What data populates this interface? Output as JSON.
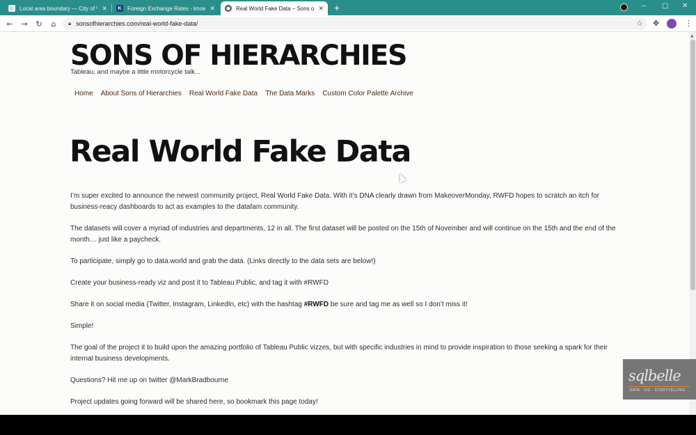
{
  "browser": {
    "tabs": [
      {
        "title": "Local area boundary — City of Va",
        "favicon": "city-logo-icon",
        "active": false
      },
      {
        "title": "Foreign Exchange Rates - knoem",
        "favicon": "knoema-k-icon",
        "favicon_text": "K",
        "active": false
      },
      {
        "title": "Real World Fake Data – Sons of Hi",
        "favicon": "sons-of-hierarchies-icon",
        "active": true
      }
    ],
    "new_tab": "+",
    "window_controls": {
      "minimize": "–",
      "maximize": "▢",
      "close": "✕"
    },
    "url": "sonsofhierarchies.com/real-world-fake-data/"
  },
  "site": {
    "title": "SONS OF HIERARCHIES",
    "tagline": "Tableau, and maybe a little motorcycle talk...",
    "nav": [
      "Home",
      "About Sons of Hierarchies",
      "Real World Fake Data",
      "The Data Marks",
      "Custom Color Palette Archive"
    ]
  },
  "post": {
    "title": "Real World Fake Data",
    "paragraphs": [
      "I’m super excited to announce the newest community project, Real World Fake Data. With it’s DNA clearly drawn from MakeoverMonday, RWFD hopes to scratch an itch for business-reacy dashboards to act as examples to the datafam community.",
      "The datasets will cover a myriad of industries and departments, 12 in all. The first dataset will be posted on the 15th of November and will continue on the 15th and the end of the month… just like a paycheck.",
      "To participate, simply go to data.world and grab the data. (Links directly to the data sets are below!)",
      "Create your business-ready viz and post it to Tableau Public, and tag it with #RWFD"
    ],
    "share": {
      "before": "Share it on social media (Twitter, Instagram, LinkedIn, etc) with the hashtag ",
      "hashtag": "#RWFD",
      "after": " be sure and tag me as well so I don’t miss it!"
    },
    "paragraphs_after": [
      "Simple!",
      "The goal of the project it to build upon the amazing portfolio of Tableau Public vizzes, but with specific industries in mind to provide inspiration to those seeking a spark for their internal business developments.",
      "Questions? Hit me up on twitter @MarkBradbourne",
      "Project updates going forward will be shared here, so bookmark this page today!"
    ]
  },
  "watermark": {
    "brand": "sqlbelle",
    "tagline": "DATA · VIZ · STORYTELLING"
  },
  "colors": {
    "tab_strip": "#2a8e8a",
    "page_bg": "#fcfcfb",
    "nav_link": "#4a2a0e",
    "watermark_accent": "#f07d0c"
  }
}
